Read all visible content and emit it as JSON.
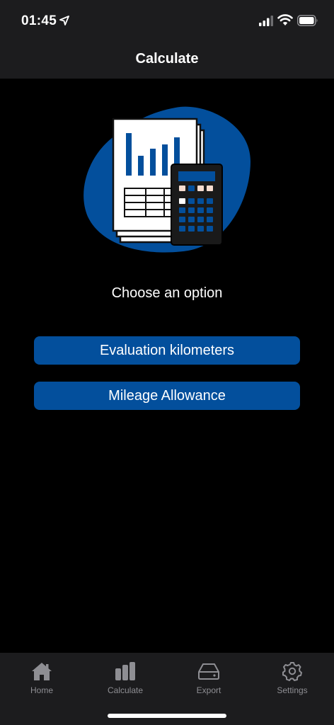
{
  "status_bar": {
    "time": "01:45",
    "icons": [
      "location-arrow-icon",
      "cellular-signal-icon",
      "wifi-icon",
      "battery-icon"
    ]
  },
  "nav": {
    "title": "Calculate"
  },
  "hero": {
    "icon": "report-calculator-illustration"
  },
  "main": {
    "prompt": "Choose an option",
    "options": [
      {
        "label": "Evaluation kilometers"
      },
      {
        "label": "Mileage Allowance"
      }
    ]
  },
  "tabs": [
    {
      "label": "Home",
      "icon": "home-icon"
    },
    {
      "label": "Calculate",
      "icon": "bar-chart-icon"
    },
    {
      "label": "Export",
      "icon": "drive-icon"
    },
    {
      "label": "Settings",
      "icon": "gear-icon"
    }
  ],
  "colors": {
    "accent": "#034f9c",
    "background": "#000000",
    "bar_background": "#1c1c1e",
    "tab_inactive": "#8e8e93"
  }
}
